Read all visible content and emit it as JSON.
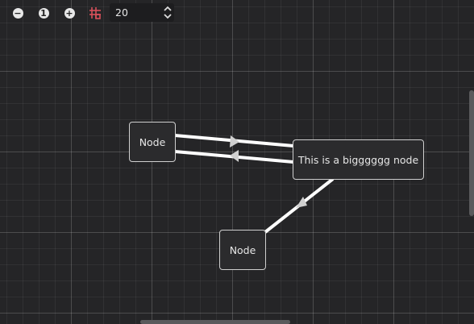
{
  "toolbar": {
    "zoom_out_icon": "minus-circle-icon",
    "zoom_reset_glyph": "1",
    "zoom_in_icon": "plus-circle-icon",
    "snap_icon": "grid-snap-icon",
    "snap_icon_color": "#d9505a",
    "snap_distance": "20",
    "spinner_icon": "up-down-arrows-icon"
  },
  "nodes": [
    {
      "id": "node-1",
      "label": "Node"
    },
    {
      "id": "node-2",
      "label": "This is a bigggggg node"
    },
    {
      "id": "node-3",
      "label": "Node"
    }
  ],
  "connections": [
    {
      "from": "node-1",
      "to": "node-2"
    },
    {
      "from": "node-2",
      "to": "node-1"
    },
    {
      "from": "node-3",
      "to": "node-2"
    }
  ],
  "colors": {
    "background": "#252527",
    "node_border": "#cfcfcf",
    "wire": "#ffffff",
    "arrow": "#d0d0d0"
  }
}
